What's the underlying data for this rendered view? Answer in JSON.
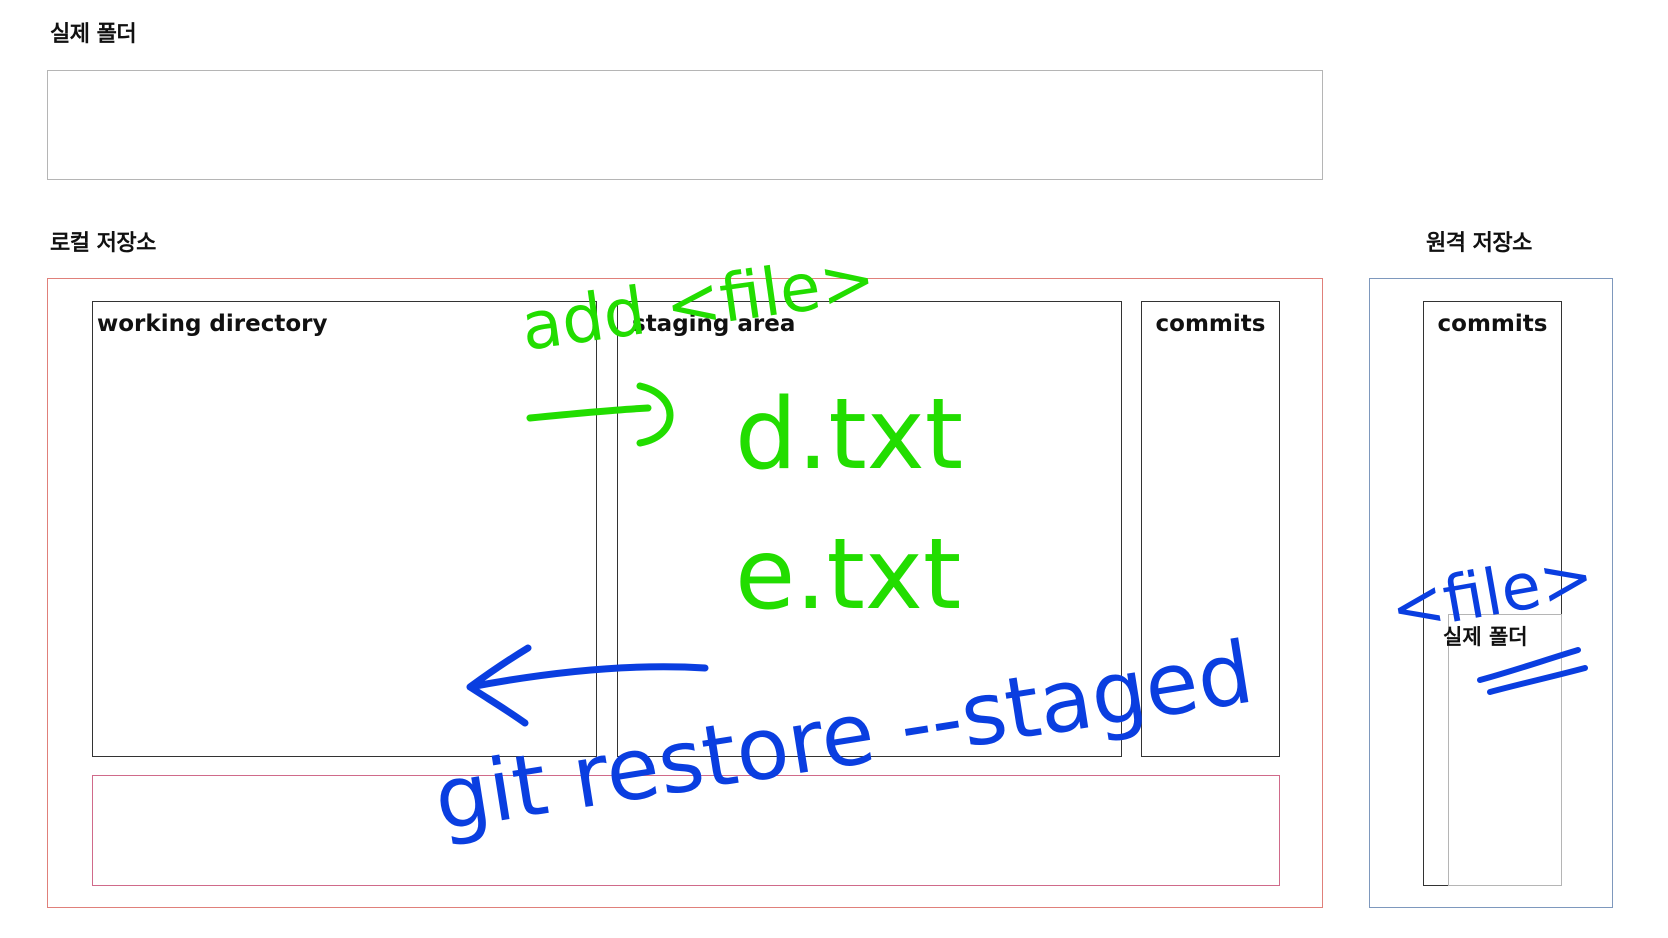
{
  "colors": {
    "annotation_green": "#22dd00",
    "annotation_blue": "#0a3ee0"
  },
  "working_folder": {
    "label": "실제 폴더"
  },
  "local_repo": {
    "label": "로컬 저장소",
    "areas": {
      "working_directory": "working directory",
      "staging_area": "staging area",
      "commits": "commits"
    }
  },
  "remote_repo": {
    "label": "원격 저장소",
    "commits": "commits",
    "inner_folder": "실제 폴더"
  },
  "annotations": {
    "add_command": "add <file>",
    "staged_file_1": "d.txt",
    "staged_file_2": "e.txt",
    "restore_command": "git restore --staged",
    "remote_file": "<file>"
  }
}
